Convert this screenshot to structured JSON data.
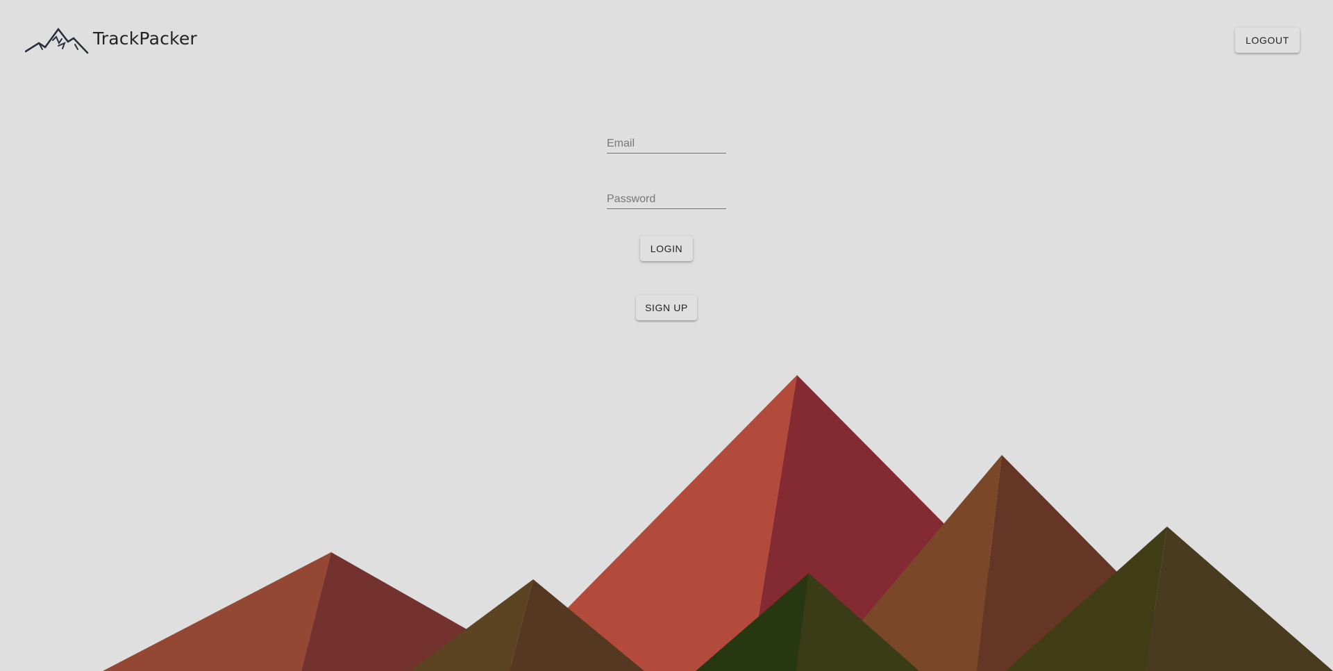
{
  "header": {
    "brand_name": "TrackPacker",
    "logo_icon": "mountain-logo-icon",
    "logout_label": "LOGOUT"
  },
  "login_form": {
    "email_placeholder": "Email",
    "email_value": "",
    "password_placeholder": "Password",
    "password_value": "",
    "login_label": "LOGIN",
    "signup_label": "SIGN UP"
  },
  "colors": {
    "background": "#dfdfdf",
    "button_bg": "#e0e0e0",
    "text": "#222222",
    "mountain_red_light": "#b34b3d",
    "mountain_red_dark": "#842a32",
    "mountain_rust_light": "#944833",
    "mountain_rust_dark": "#74322f",
    "mountain_brown_light": "#7a4829",
    "mountain_brown_dark": "#653525",
    "mountain_ochre_light": "#5c4322",
    "mountain_ochre_dark": "#553821",
    "mountain_green_light": "#263711",
    "mountain_green_dark": "#3a3b17",
    "mountain_olive_light": "#413e17",
    "mountain_olive_dark": "#483b1f"
  }
}
